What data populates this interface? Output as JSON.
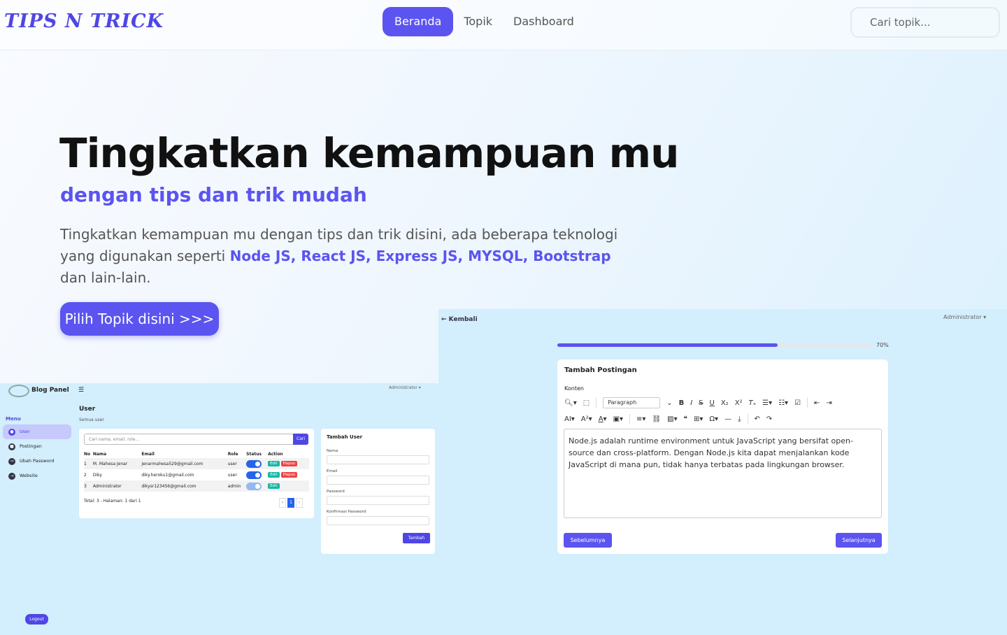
{
  "brand": {
    "logo": "TIPS N TRICK"
  },
  "nav": {
    "items": [
      {
        "label": "Beranda"
      },
      {
        "label": "Topik"
      },
      {
        "label": "Dashboard"
      }
    ],
    "search_placeholder": "Cari topik..."
  },
  "hero": {
    "title": "Tingkatkan kemampuan mu",
    "subtitle": "dengan tips dan trik mudah",
    "desc_before": "Tingkatkan kemampuan mu dengan tips dan trik disini, ada beberapa teknologi yang digunakan seperti ",
    "desc_highlight": "Node JS, React JS, Express JS, MYSQL, Bootstrap",
    "desc_after": " dan lain-lain.",
    "cta": "Pilih Topik disini >>>"
  },
  "panel": {
    "title": "Blog Panel",
    "admin": "Administrator ▾",
    "menu_label": "Menu",
    "menu": [
      {
        "label": "User",
        "icon": "user-icon"
      },
      {
        "label": "Postingan",
        "icon": "post-icon"
      },
      {
        "label": "Ubah Password",
        "icon": "key-icon"
      },
      {
        "label": "Website",
        "icon": "globe-icon"
      }
    ],
    "page_title": "User",
    "page_sub": "Semua user",
    "search_placeholder": "Cari nama, email, role...",
    "search_btn": "Cari",
    "columns": [
      "No",
      "Nama",
      "Email",
      "Role",
      "Status",
      "Action"
    ],
    "rows": [
      {
        "no": "1",
        "nama": "M. Mahesa Jenar",
        "email": "jenarmahesa529@gmail.com",
        "role": "user",
        "status": true
      },
      {
        "no": "2",
        "nama": "Diky",
        "email": "diky.heroku1@gmail.com",
        "role": "user",
        "status": true
      },
      {
        "no": "3",
        "nama": "Administrator",
        "email": "dikysr123456@gmail.com",
        "role": "admin",
        "status": false
      }
    ],
    "edit": "Edit",
    "delete": "Hapus",
    "total": "Total: 3 - Halaman: 1 dari 1",
    "pager": {
      "prev": "‹",
      "page": "1",
      "next": "›"
    },
    "form_title": "Tambah User",
    "fields": [
      "Nama",
      "Email",
      "Password",
      "Konfirmasi Password"
    ],
    "add_btn": "Tambah",
    "logout": "Logout"
  },
  "editor": {
    "back": "← Kembali",
    "admin": "Administrator ▾",
    "progress": 70,
    "progress_label": "70%",
    "card_title": "Tambah Postingan",
    "field_label": "Konten",
    "paragraph": "Paragraph",
    "content": "Node.js adalah runtime environment untuk JavaScript yang bersifat open-source dan cross-platform. Dengan Node.js kita dapat menjalankan kode JavaScript di mana pun, tidak hanya terbatas pada lingkungan browser.",
    "prev": "Sebelumnya",
    "next": "Selanjutnya"
  },
  "colors": {
    "accent": "#5b54f0",
    "panel_bg": "#d3eefc"
  }
}
